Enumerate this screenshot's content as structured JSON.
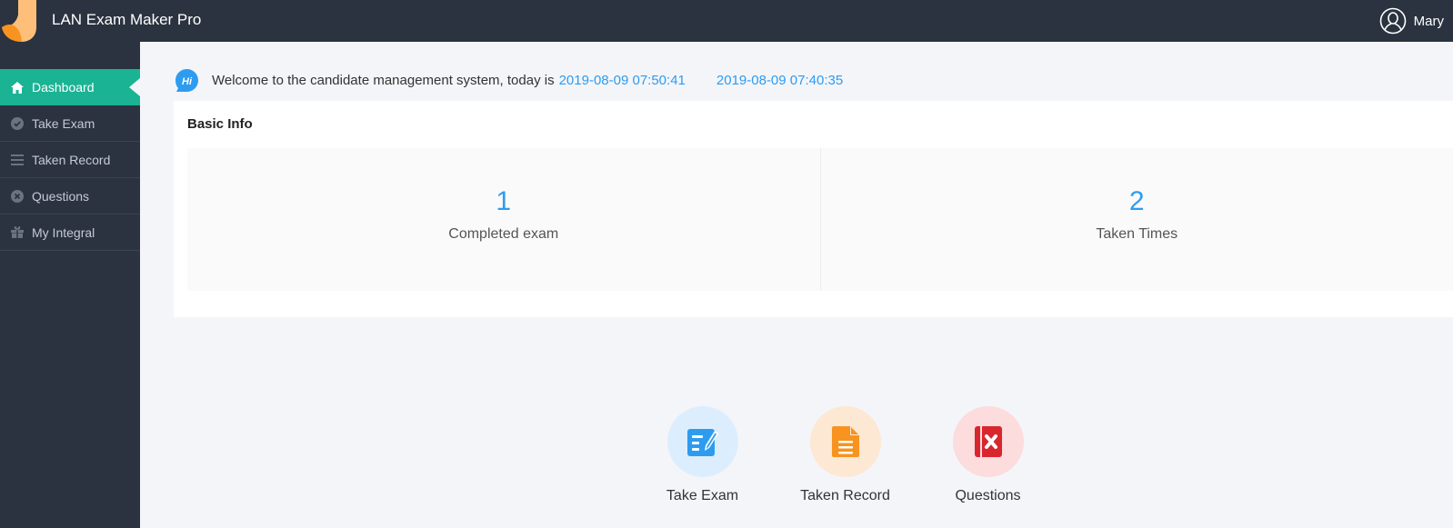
{
  "header": {
    "app_title": "LAN Exam Maker Pro",
    "user_name": "Mary",
    "logo_colors": {
      "dark": "#f7931e",
      "light": "#fdbf7a"
    }
  },
  "sidebar": {
    "items": [
      {
        "label": "Dashboard",
        "icon": "home-icon",
        "active": true
      },
      {
        "label": "Take Exam",
        "icon": "check-circle-icon",
        "active": false
      },
      {
        "label": "Taken Record",
        "icon": "list-icon",
        "active": false
      },
      {
        "label": "Questions",
        "icon": "x-circle-icon",
        "active": false
      },
      {
        "label": "My Integral",
        "icon": "gift-icon",
        "active": false
      }
    ],
    "active_color": "#1ab394"
  },
  "welcome": {
    "badge": "Hi",
    "text": "Welcome to the candidate management system, today is",
    "date_current": "2019-08-09 07:50:41",
    "date_second": "2019-08-09 07:40:35"
  },
  "basic_info": {
    "title": "Basic Info",
    "stats": [
      {
        "value": "1",
        "label": "Completed exam"
      },
      {
        "value": "2",
        "label": "Taken Times"
      }
    ]
  },
  "shortcuts": [
    {
      "label": "Take Exam",
      "icon": "edit-document-icon",
      "bg": "#dceefe",
      "color": "#2d9cf0"
    },
    {
      "label": "Taken Record",
      "icon": "file-icon",
      "bg": "#fde8d3",
      "color": "#f7931e"
    },
    {
      "label": "Questions",
      "icon": "wrong-book-icon",
      "bg": "#fcdcdc",
      "color": "#d9262e"
    }
  ]
}
